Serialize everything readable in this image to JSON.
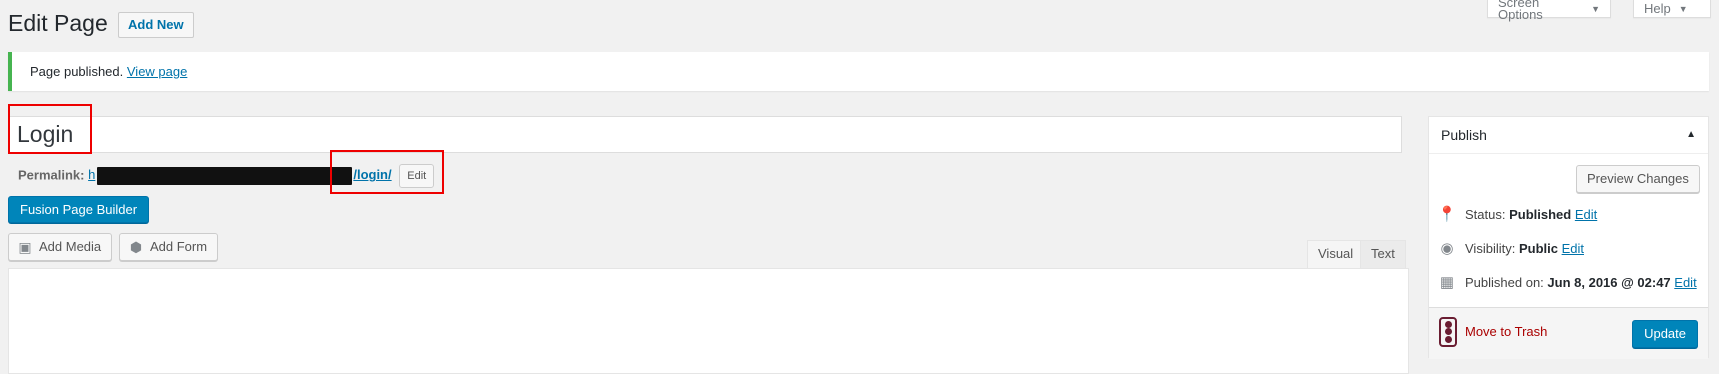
{
  "header": {
    "title": "Edit Page",
    "add_new": "Add New",
    "screen_options": "Screen Options",
    "help": "Help"
  },
  "notice": {
    "text": "Page published.",
    "link": "View page"
  },
  "editor": {
    "title_value": "Login",
    "permalink_label": "Permalink:",
    "permalink_prefix": "h",
    "permalink_suffix": "/login/",
    "permalink_edit": "Edit",
    "fusion_button": "Fusion Page Builder",
    "add_media": "Add Media",
    "add_form": "Add Form",
    "tab_visual": "Visual",
    "tab_text": "Text"
  },
  "publish": {
    "heading": "Publish",
    "preview_button": "Preview Changes",
    "status_label": "Status:",
    "status_value": "Published",
    "visibility_label": "Visibility:",
    "visibility_value": "Public",
    "published_label": "Published on:",
    "published_value": "Jun 8, 2016 @ 02:47",
    "edit_link": "Edit",
    "move_to_trash": "Move to Trash",
    "update_button": "Update"
  },
  "colors": {
    "accent": "#0085ba",
    "link": "#0073aa",
    "notice_border": "#46b450",
    "trash": "#a00",
    "annotation": "#e00"
  }
}
